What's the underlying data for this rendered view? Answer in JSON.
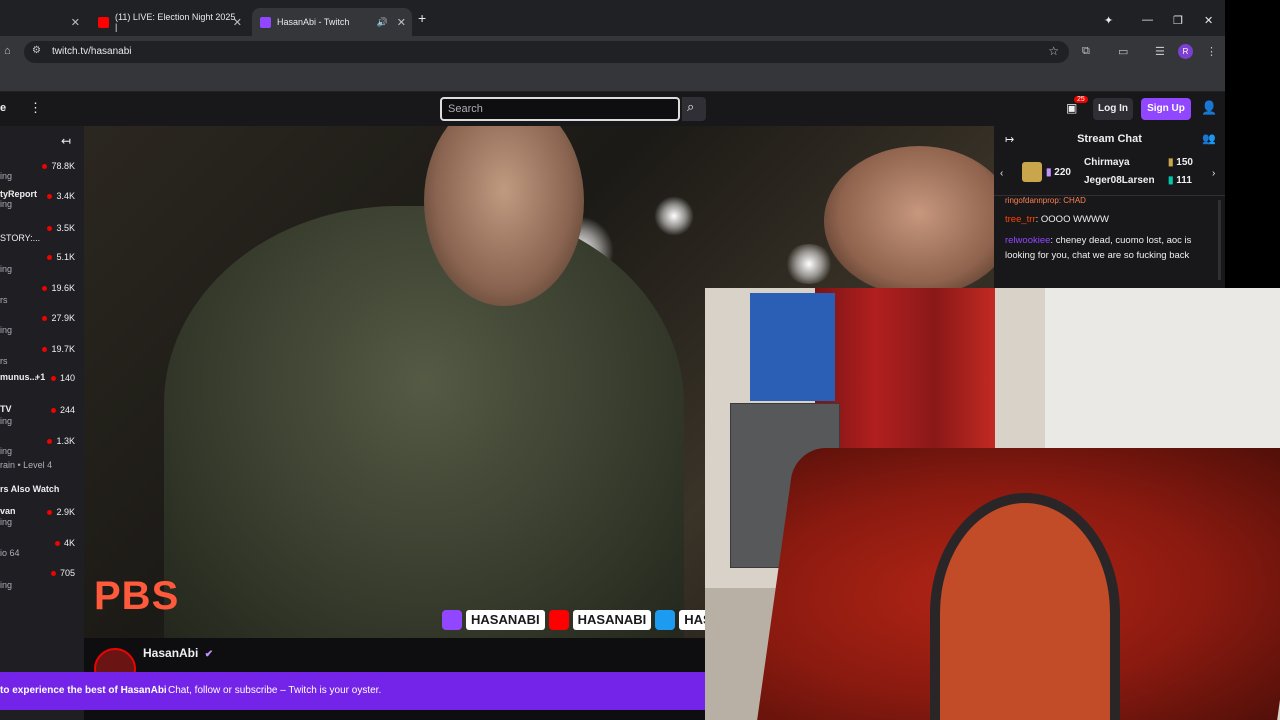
{
  "browser": {
    "tabs": [
      {
        "label": "",
        "active": false
      },
      {
        "label": "(11) LIVE: Election Night 2025 |",
        "active": false
      },
      {
        "label": "HasanAbi - Twitch",
        "active": true
      }
    ],
    "url": "twitch.tv/hasanabi",
    "profile_initial": "R"
  },
  "topnav": {
    "search_placeholder": "Search",
    "notification_count": "25",
    "login_label": "Log In",
    "signup_label": "Sign Up"
  },
  "sidebar": {
    "channels": [
      {
        "name": "",
        "game": "ing",
        "viewers": "78.8K"
      },
      {
        "name": "tyReport",
        "game": "ing",
        "viewers": "3.4K"
      },
      {
        "name": "STORY:...",
        "game": "",
        "viewers": "3.5K"
      },
      {
        "name": "",
        "game": "ing",
        "viewers": "5.1K"
      },
      {
        "name": "",
        "game": "rs",
        "viewers": "19.6K"
      },
      {
        "name": "",
        "game": "ing",
        "viewers": "27.9K"
      },
      {
        "name": "",
        "game": "rs",
        "viewers": "19.7K"
      },
      {
        "name": "munus...",
        "game": "",
        "viewers": "140",
        "extra": "+1"
      },
      {
        "name": "TV",
        "game": "ing",
        "viewers": "244"
      },
      {
        "name": "",
        "game": "ing",
        "viewers": "1.3K"
      }
    ],
    "last_game": "rain • Level 4",
    "also_watch_heading": "rs Also Watch",
    "also_watch": [
      {
        "name": "van",
        "game": "ing",
        "viewers": "2.9K"
      },
      {
        "name": "",
        "game": "io 64",
        "viewers": "4K"
      },
      {
        "name": "",
        "game": "ing",
        "viewers": "705"
      }
    ]
  },
  "video": {
    "logo_text": "PBS",
    "ticker": [
      "HASANABI",
      "HASANABI",
      "HASAN"
    ]
  },
  "channel": {
    "name": "HasanAbi"
  },
  "promo": {
    "bold": "to experience the best of HasanAbi",
    "text": "Chat, follow or subscribe – Twitch is your oyster."
  },
  "chat": {
    "title": "Stream Chat",
    "gift_count": "220",
    "gifters": [
      {
        "name": "Chirmaya",
        "count": "150"
      },
      {
        "name": "Jeger08Larsen",
        "count": "111"
      }
    ],
    "messages": [
      {
        "user": "tree_trr",
        "user_color": "#ff4500",
        "text": "OOOO WWWW"
      },
      {
        "user": "relwookiee",
        "user_color": "#9147ff",
        "text": "cheney dead, cuomo lost, aoc is looking for you, chat we are so fucking back"
      }
    ],
    "partial_top": "ringofdannprop: CHAD"
  },
  "colors": {
    "twitch_purple": "#9147ff",
    "promo_purple": "#7424e8",
    "live_red": "#eb0400"
  }
}
